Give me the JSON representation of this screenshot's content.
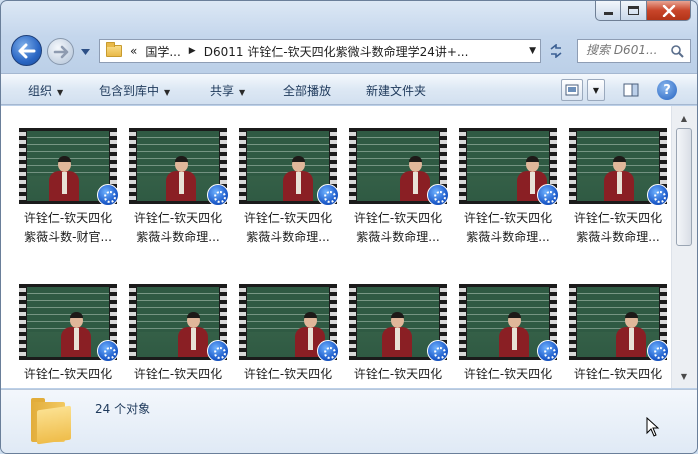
{
  "window": {
    "caption_buttons": [
      "minimize",
      "maximize",
      "close"
    ]
  },
  "address_bar": {
    "overflow": "«",
    "crumbs": [
      "国学...",
      "D6011 许铨仁-钦天四化紫微斗数命理学24讲+..."
    ],
    "refresh_icon": "refresh-icon"
  },
  "search": {
    "placeholder": "搜索 D601..."
  },
  "toolbar": {
    "organize": "组织",
    "include_in_library": "包含到库中",
    "share": "共享",
    "play_all": "全部播放",
    "new_folder": "新建文件夹"
  },
  "files": [
    {
      "line1": "许铨仁-钦天四化",
      "line2": "紫薇斗数-财官..."
    },
    {
      "line1": "许铨仁-钦天四化",
      "line2": "紫薇斗数命理..."
    },
    {
      "line1": "许铨仁-钦天四化",
      "line2": "紫薇斗数命理..."
    },
    {
      "line1": "许铨仁-钦天四化",
      "line2": "紫薇斗数命理..."
    },
    {
      "line1": "许铨仁-钦天四化",
      "line2": "紫薇斗数命理..."
    },
    {
      "line1": "许铨仁-钦天四化",
      "line2": "紫薇斗数命理..."
    },
    {
      "line1": "许铨仁-钦天四化",
      "line2": ""
    },
    {
      "line1": "许铨仁-钦天四化",
      "line2": ""
    },
    {
      "line1": "许铨仁-钦天四化",
      "line2": ""
    },
    {
      "line1": "许铨仁-钦天四化",
      "line2": ""
    },
    {
      "line1": "许铨仁-钦天四化",
      "line2": ""
    },
    {
      "line1": "许铨仁-钦天四化",
      "line2": ""
    }
  ],
  "details": {
    "count_text": "24 个对象"
  },
  "colors": {
    "chrome": "#c4d6ec",
    "command_text": "#1e395b",
    "badge": "#1a58c8"
  }
}
